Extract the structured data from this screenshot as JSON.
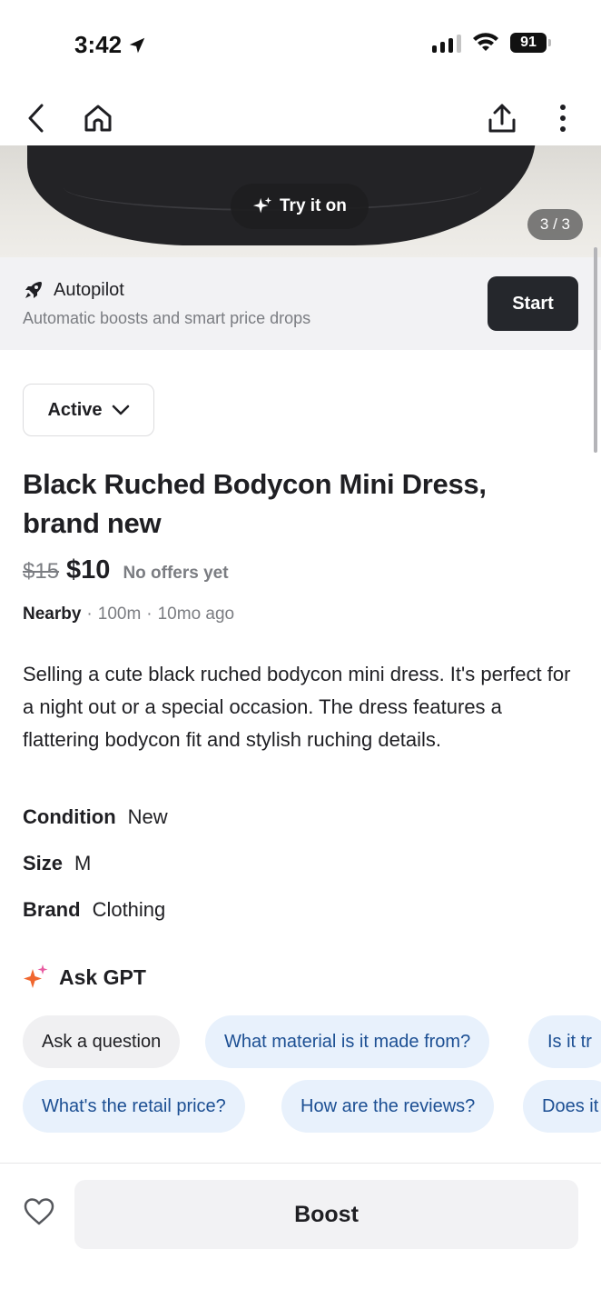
{
  "status_bar": {
    "time": "3:42",
    "battery": "91"
  },
  "photo": {
    "try_on_label": "Try it on",
    "page_counter": "3 / 3"
  },
  "autopilot": {
    "title": "Autopilot",
    "subtitle": "Automatic boosts and smart price drops",
    "start_label": "Start"
  },
  "listing": {
    "status": "Active",
    "title": "Black Ruched Bodycon Mini Dress, brand new",
    "original_price": "$15",
    "price": "$10",
    "offers": "No offers yet",
    "location": "Nearby",
    "distance": "100m",
    "posted": "10mo ago",
    "description": "Selling a cute black ruched bodycon mini dress. It's perfect for a night out or a special occasion. The dress features a flattering bodycon fit and stylish ruching details.",
    "attributes": [
      {
        "key": "Condition",
        "value": "New"
      },
      {
        "key": "Size",
        "value": "M"
      },
      {
        "key": "Brand",
        "value": "Clothing"
      }
    ]
  },
  "ask_gpt": {
    "title": "Ask GPT",
    "row1": [
      "Ask a question",
      "What material is it made from?",
      "Is it tr"
    ],
    "row2": [
      "What's the retail price?",
      "How are the reviews?",
      "Does it"
    ]
  },
  "bottom_bar": {
    "boost_label": "Boost"
  },
  "colors": {
    "accent_blue_text": "#1c4f93",
    "chip_blue_bg": "#e8f1fc",
    "dark_button": "#25272c",
    "muted_text": "#7b7d82"
  }
}
